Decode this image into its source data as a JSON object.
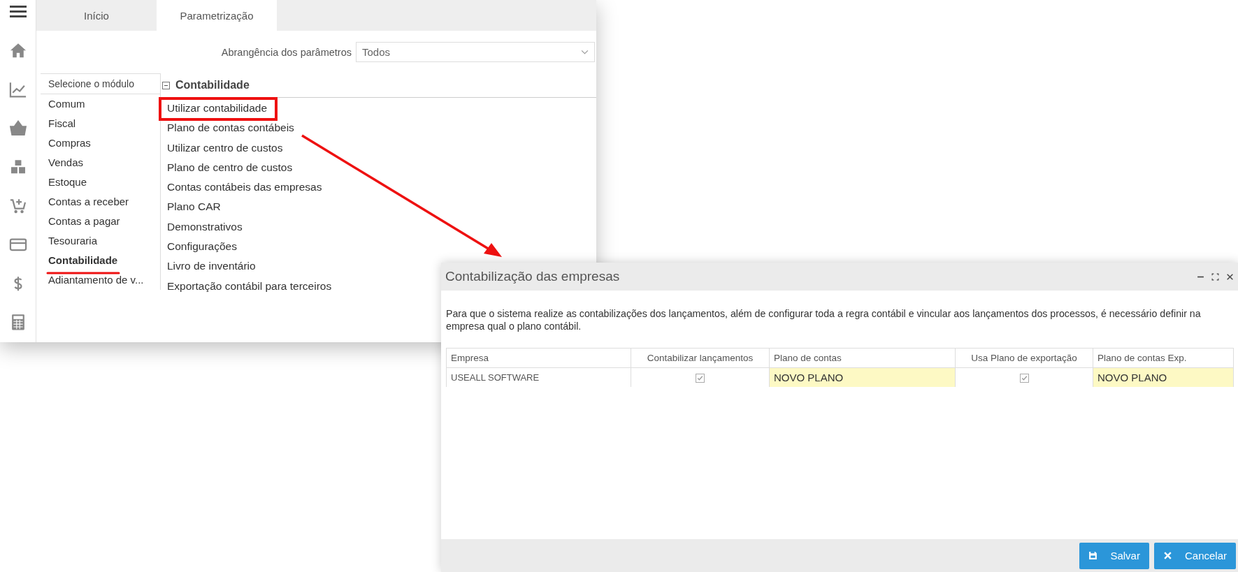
{
  "tabs": [
    {
      "label": "Início",
      "selected": false
    },
    {
      "label": "Parametrização",
      "selected": true
    }
  ],
  "scope": {
    "label": "Abrangência dos parâmetros",
    "value": "Todos"
  },
  "modules": {
    "header": "Selecione o módulo",
    "items": [
      {
        "label": "Comum",
        "selected": false
      },
      {
        "label": "Fiscal",
        "selected": false
      },
      {
        "label": "Compras",
        "selected": false
      },
      {
        "label": "Vendas",
        "selected": false
      },
      {
        "label": "Estoque",
        "selected": false
      },
      {
        "label": "Contas a receber",
        "selected": false
      },
      {
        "label": "Contas a pagar",
        "selected": false
      },
      {
        "label": "Tesouraria",
        "selected": false
      },
      {
        "label": "Contabilidade",
        "selected": true
      },
      {
        "label": "Adiantamento de v..."
      }
    ]
  },
  "section": {
    "title": "Contabilidade",
    "expanded": true,
    "items": [
      "Utilizar contabilidade",
      "Plano de contas contábeis",
      "Utilizar centro de custos",
      "Plano de centro de custos",
      "Contas contábeis das empresas",
      "Plano CAR",
      "Demonstrativos",
      "Configurações",
      "Livro de inventário",
      "Exportação contábil para terceiros"
    ]
  },
  "dialog": {
    "title": "Contabilização das empresas",
    "description": "Para que o sistema realize as contabilizações dos lançamentos, além de configurar toda a regra contábil e vincular aos lançamentos dos processos, é necessário definir na empresa qual o plano contábil.",
    "columns": [
      {
        "label": "Empresa",
        "kind": "text"
      },
      {
        "label": "Contabilizar lançamentos",
        "kind": "check"
      },
      {
        "label": "Plano de contas",
        "kind": "edit"
      },
      {
        "label": "Usa Plano de exportação",
        "kind": "check"
      },
      {
        "label": "Plano de contas Exp.",
        "kind": "edit"
      }
    ],
    "rows": [
      {
        "cells": [
          {
            "value": "USEALL SOFTWARE"
          },
          {
            "checked": true
          },
          {
            "value": "NOVO PLANO"
          },
          {
            "checked": true
          },
          {
            "value": "NOVO PLANO"
          }
        ]
      }
    ],
    "buttons": [
      {
        "label": "Salvar",
        "kind": "save"
      },
      {
        "label": "Cancelar",
        "kind": "cancel"
      }
    ]
  }
}
